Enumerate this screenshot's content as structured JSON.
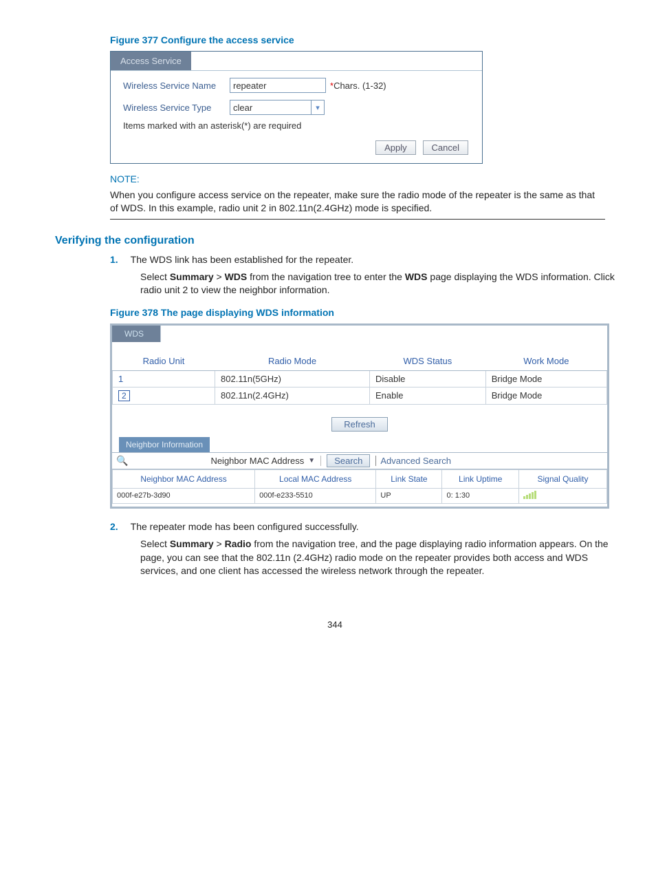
{
  "figure377": {
    "caption": "Figure 377 Configure the access service",
    "tab": "Access Service",
    "name_label": "Wireless Service Name",
    "name_value": "repeater",
    "name_hint_star": "*",
    "name_hint_rest": "Chars. (1-32)",
    "type_label": "Wireless Service Type",
    "type_value": "clear",
    "required_note": "Items marked with an asterisk(*) are required",
    "apply": "Apply",
    "cancel": "Cancel"
  },
  "note": {
    "label": "NOTE:",
    "body": "When you configure access service on the repeater, make sure the radio mode of the repeater is the same as that of WDS. In this example, radio unit 2 in 802.11n(2.4GHz) mode is specified."
  },
  "verify_heading": "Verifying the configuration",
  "step1": {
    "num": "1.",
    "text": "The WDS link has been established for the repeater.",
    "para_a": "Select ",
    "para_b": "Summary",
    "para_c": " > ",
    "para_d": "WDS",
    "para_e": " from the navigation tree to enter the ",
    "para_f": "WDS",
    "para_g": " page displaying the WDS information. Click radio unit 2 to view the neighbor information."
  },
  "figure378": {
    "caption": "Figure 378 The page displaying WDS information",
    "tab": "WDS",
    "headers": {
      "radio_unit": "Radio Unit",
      "radio_mode": "Radio Mode",
      "wds_status": "WDS Status",
      "work_mode": "Work Mode"
    },
    "rows": [
      {
        "unit": "1",
        "mode": "802.11n(5GHz)",
        "status": "Disable",
        "work": "Bridge Mode"
      },
      {
        "unit": "2",
        "mode": "802.11n(2.4GHz)",
        "status": "Enable",
        "work": "Bridge Mode"
      }
    ],
    "refresh": "Refresh",
    "neighbor_tab": "Neighbor Information",
    "search_field": "Neighbor MAC Address",
    "search_btn": "Search",
    "adv_search": "Advanced Search",
    "nheaders": {
      "nmac": "Neighbor MAC Address",
      "lmac": "Local MAC Address",
      "lstate": "Link State",
      "uptime": "Link Uptime",
      "signal": "Signal Quality"
    },
    "nrow": {
      "nmac": "000f-e27b-3d90",
      "lmac": "000f-e233-5510",
      "lstate": "UP",
      "uptime": "0: 1:30"
    }
  },
  "step2": {
    "num": "2.",
    "text": "The repeater mode has been configured successfully.",
    "para_a": "Select ",
    "para_b": "Summary",
    "para_c": " > ",
    "para_d": "Radio",
    "para_e": " from the navigation tree, and the page displaying radio information appears. On the page, you can see that the 802.11n (2.4GHz) radio mode on the repeater provides both access and WDS services, and one client has accessed the wireless network through the repeater."
  },
  "page_number": "344"
}
